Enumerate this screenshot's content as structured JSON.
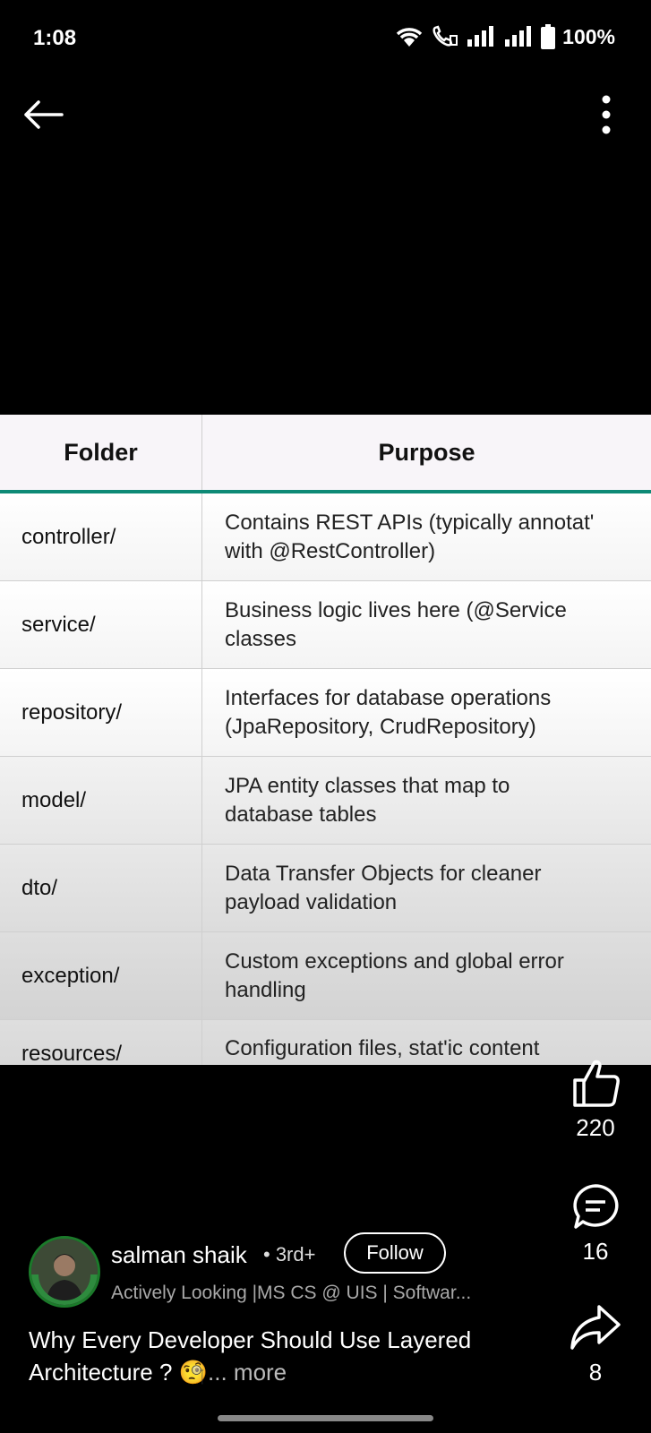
{
  "status_bar": {
    "time": "1:08",
    "battery": "100%"
  },
  "table": {
    "headers": [
      "Folder",
      "Purpose"
    ],
    "rows": [
      {
        "folder": "controller/",
        "purpose": "Contains REST APIs (typically annotat'\nwith @RestController)"
      },
      {
        "folder": "service/",
        "purpose": "Business logic lives here (@Service\nclasses"
      },
      {
        "folder": "repository/",
        "purpose": "Interfaces for database operations\n(JpaRepository, CrudRepository)"
      },
      {
        "folder": "model/",
        "purpose": "JPA entity classes that map to\ndatabase tables"
      },
      {
        "folder": "dto/",
        "purpose": "Data Transfer Objects for cleaner\npayload validation"
      },
      {
        "folder": "exception/",
        "purpose": "Custom exceptions and global error\nhandling"
      },
      {
        "folder": "resources/",
        "purpose": "Configuration files, stat'ic content"
      }
    ]
  },
  "actions": {
    "likes": "220",
    "comments": "16",
    "shares": "8"
  },
  "author": {
    "name": "salman shaik",
    "degree": "• 3rd+",
    "follow_label": "Follow",
    "headline": "Actively Looking |MS CS @ UIS | Softwar...",
    "avatar_badge": "#OPENTOWORK"
  },
  "post": {
    "caption": "Why Every  Developer Should Use Layered Architecture ? 🧐",
    "more_label": "... more"
  },
  "colors": {
    "accent": "#0e8a76",
    "background": "#000000"
  }
}
